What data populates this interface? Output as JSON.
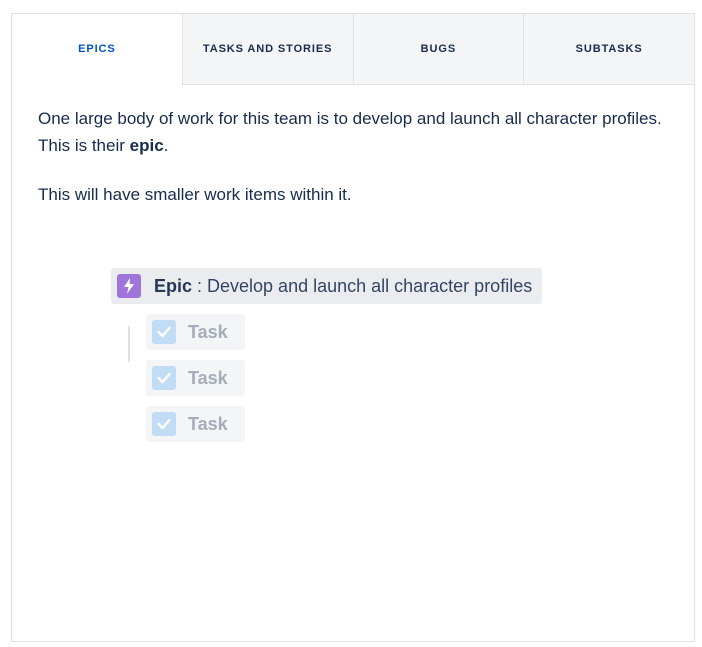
{
  "tabs": [
    {
      "label": "EPICS",
      "active": true
    },
    {
      "label": "TASKS AND STORIES",
      "active": false
    },
    {
      "label": "BUGS",
      "active": false
    },
    {
      "label": "SUBTASKS",
      "active": false
    }
  ],
  "content": {
    "para1_main": "One large body of work for this team is to develop and launch all character profiles. This is their ",
    "para1_bold": "epic",
    "para1_end": ".",
    "para2": "This will have smaller work items within it."
  },
  "diagram": {
    "epic_word": "Epic",
    "epic_text": " : Develop and launch all character profiles",
    "epic_icon": "lightning-bolt-icon",
    "tasks": [
      {
        "label": "Task",
        "icon": "checkbox-check-icon"
      },
      {
        "label": "Task",
        "icon": "checkbox-check-icon"
      },
      {
        "label": "Task",
        "icon": "checkbox-check-icon"
      }
    ]
  },
  "colors": {
    "active_tab": "#0052cc",
    "epic_icon": "#9f75db",
    "task_icon": "#c1dcf5",
    "task_text": "#a5adba"
  }
}
